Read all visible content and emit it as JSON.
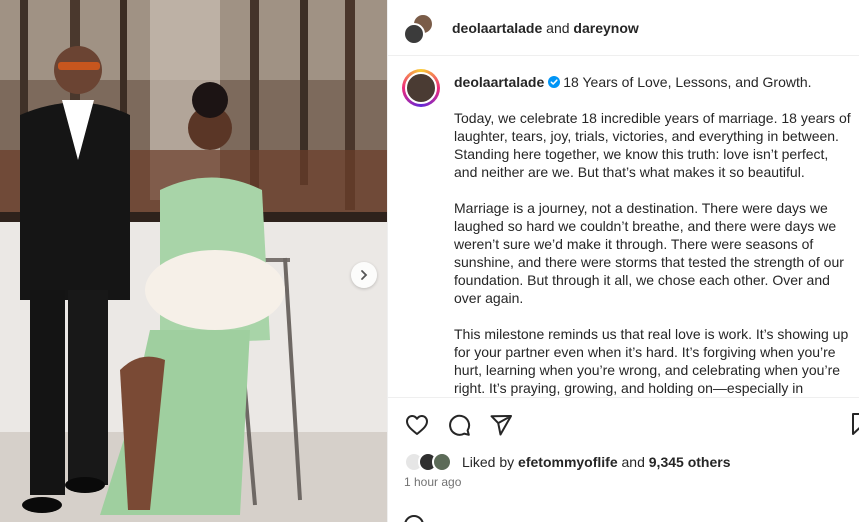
{
  "header": {
    "user1": "deolaartalade",
    "connector": "and",
    "user2": "dareynow"
  },
  "caption": {
    "username": "deolaartalade",
    "paragraphs": [
      "18 Years of Love, Lessons, and Growth.",
      "Today, we celebrate 18 incredible years of marriage. 18 years of laughter, tears, joy, trials, victories, and everything in between. Standing here together, we know this truth: love isn’t perfect, and neither are we. But that’s what makes it so beautiful.",
      "Marriage is a journey, not a destination. There were days we laughed so hard we couldn’t breathe, and there were days we weren’t sure we’d make it through. There were seasons of sunshine, and there were storms that tested the strength of our foundation. But through it all, we chose each other. Over and over again.",
      "This milestone reminds us that real love is work. It’s showing up for your partner even when it’s hard. It’s forgiving when you’re hurt, learning when you’re wrong, and celebrating when you’re right. It’s praying, growing, and holding on—especially in"
    ]
  },
  "likes": {
    "prefix": "Liked by",
    "user": "efetommyoflife",
    "middle": "and",
    "count": "9,345 others"
  },
  "timestamp": "1 hour ago",
  "icons": {
    "like": "heart-icon",
    "comment": "comment-icon",
    "share": "share-icon",
    "save": "bookmark-icon",
    "verified": "verified-badge-icon",
    "next": "chevron-right-icon"
  },
  "colors": {
    "verified": "#0095f6",
    "text": "#262626",
    "muted": "#737373"
  }
}
